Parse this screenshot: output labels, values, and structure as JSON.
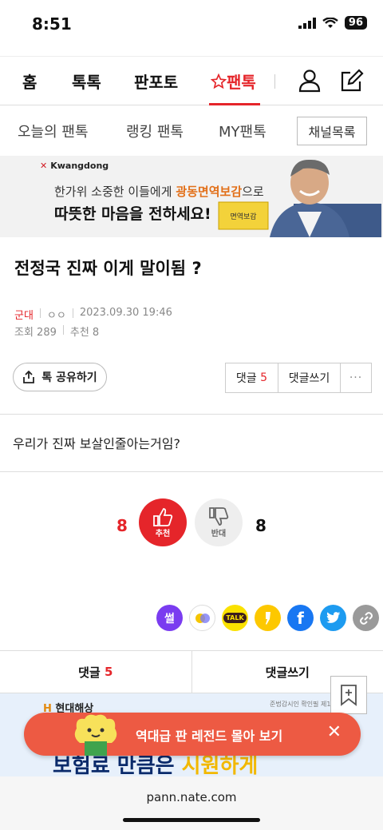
{
  "status": {
    "time": "8:51",
    "battery": "96"
  },
  "nav": {
    "home": "홈",
    "toktok": "톡톡",
    "panpoto": "판포토",
    "pantok": "팬톡"
  },
  "subnav": {
    "today": "오늘의 팬톡",
    "ranking": "랭킹 팬톡",
    "my": "MY팬톡",
    "channels": "채널목록"
  },
  "ad": {
    "brand": "Kwangdong",
    "line1_pre": "한가위 소중한 이들에게 ",
    "line1_hl": "광동면역보감",
    "line1_post": "으로",
    "line2": "따뜻한 마음을 전하세요!",
    "product": "면역보감"
  },
  "post": {
    "title": "전정국 진짜 이게 말이됨 ?",
    "category": "군대",
    "author": "ㅇㅇ",
    "date": "2023.09.30 19:46",
    "views": "조회 289",
    "recommends": "추천 8",
    "body": "우리가 진짜 보살인줄아는거임?"
  },
  "actions": {
    "share": "톡 공유하기",
    "comments_label": "댓글",
    "comments_count": "5",
    "write_comment": "댓글쓰기",
    "more": "···"
  },
  "vote": {
    "up_count": "8",
    "up_label": "추천",
    "down_count": "8",
    "down_label": "반대"
  },
  "share_icons": [
    {
      "name": "ssul-icon",
      "label": "썰",
      "color": "#7a3cf0"
    },
    {
      "name": "circle-icon",
      "label": "",
      "color": "#ffffff"
    },
    {
      "name": "kakaotalk-icon",
      "label": "TALK",
      "color": "#fae100"
    },
    {
      "name": "kakaostory-icon",
      "label": "",
      "color": "#fdc800"
    },
    {
      "name": "facebook-icon",
      "label": "f",
      "color": "#1877f2"
    },
    {
      "name": "twitter-icon",
      "label": "",
      "color": "#1d9bf0"
    },
    {
      "name": "link-icon",
      "label": "",
      "color": "#9a9a9a"
    }
  ],
  "bottom": {
    "comments_label": "댓글",
    "comments_count": "5",
    "write_comment": "댓글쓰기"
  },
  "ad2": {
    "brand_h": "H",
    "brand": " 현대해상",
    "small": "준법감시인 확인필 제1031",
    "big_pre": "보험료 만큼은 ",
    "big_hl": "시원하게"
  },
  "legend_banner": {
    "text": "역대급 판 레전드 몰아 보기",
    "close": "✕"
  },
  "browser": {
    "url": "pann.nate.com"
  }
}
